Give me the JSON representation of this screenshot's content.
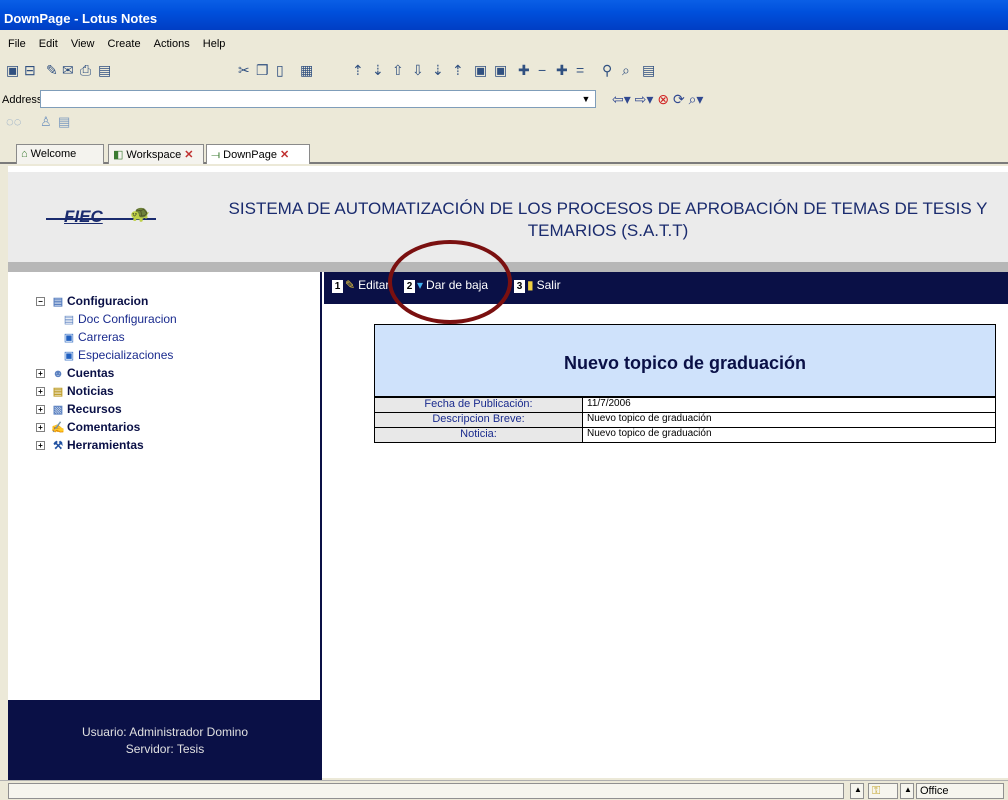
{
  "window": {
    "title": "DownPage - Lotus Notes"
  },
  "menu": [
    "File",
    "Edit",
    "View",
    "Create",
    "Actions",
    "Help"
  ],
  "address": {
    "label": "Address",
    "value": ""
  },
  "tabs": [
    {
      "label": "Welcome"
    },
    {
      "label": "Workspace"
    },
    {
      "label": "DownPage"
    }
  ],
  "header": {
    "logo_text": "FIEC",
    "title": "SISTEMA DE AUTOMATIZACIÓN DE LOS PROCESOS DE APROBACIÓN DE TEMAS DE TESIS Y TEMARIOS (S.A.T.T)"
  },
  "sidebar": {
    "items": [
      {
        "label": "Configuracion",
        "expanded": true,
        "icon": "document-icon"
      },
      {
        "label": "Doc Configuracion",
        "icon": "document-icon"
      },
      {
        "label": "Carreras",
        "icon": "view-icon"
      },
      {
        "label": "Especializaciones",
        "icon": "view-icon"
      },
      {
        "label": "Cuentas",
        "icon": "users-icon"
      },
      {
        "label": "Noticias",
        "icon": "news-icon"
      },
      {
        "label": "Recursos",
        "icon": "resource-icon"
      },
      {
        "label": "Comentarios",
        "icon": "comment-icon"
      },
      {
        "label": "Herramientas",
        "icon": "tools-icon"
      }
    ],
    "user_line": "Usuario: Administrador Domino",
    "server_line": "Servidor: Tesis"
  },
  "actions": [
    {
      "num": "1",
      "label": "Editar"
    },
    {
      "num": "2",
      "label": "Dar de baja"
    },
    {
      "num": "3",
      "label": "Salir"
    }
  ],
  "document": {
    "title": "Nuevo topico de graduación",
    "rows": [
      {
        "label": "Fecha de Publicación:",
        "value": "11/7/2006"
      },
      {
        "label": "Descripcion Breve:",
        "value": "Nuevo topico de graduación"
      },
      {
        "label": "Noticia:",
        "value": "Nuevo topico de graduación"
      }
    ]
  },
  "status": {
    "location": "Office"
  },
  "colors": {
    "navy": "#0a1046",
    "header_bg": "#cfe2fb",
    "annotation": "#7a1010"
  }
}
